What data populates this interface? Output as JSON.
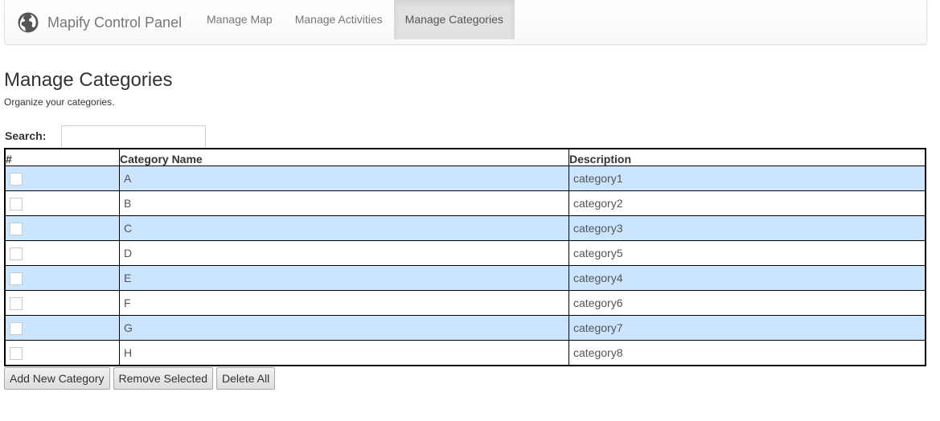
{
  "navbar": {
    "brand_icon": "globe-icon",
    "brand_label": "Mapify Control Panel",
    "items": [
      {
        "label": "Manage Map",
        "active": false
      },
      {
        "label": "Manage Activities",
        "active": false
      },
      {
        "label": "Manage Categories",
        "active": true
      }
    ]
  },
  "page": {
    "title": "Manage Categories",
    "subtitle": "Organize your categories."
  },
  "search": {
    "label": "Search:",
    "value": "",
    "placeholder": ""
  },
  "table": {
    "columns": [
      "#",
      "Category Name",
      "Description"
    ],
    "rows": [
      {
        "checked": false,
        "name": "A",
        "description": "category1"
      },
      {
        "checked": false,
        "name": "B",
        "description": "category2"
      },
      {
        "checked": false,
        "name": "C",
        "description": "category3"
      },
      {
        "checked": false,
        "name": "D",
        "description": "category5"
      },
      {
        "checked": false,
        "name": "E",
        "description": "category4"
      },
      {
        "checked": false,
        "name": "F",
        "description": "category6"
      },
      {
        "checked": false,
        "name": "G",
        "description": "category7"
      },
      {
        "checked": false,
        "name": "H",
        "description": "category8"
      }
    ],
    "row_highlight_color": "#cce5ff"
  },
  "actions": {
    "add_label": "Add New Category",
    "remove_label": "Remove Selected",
    "delete_all_label": "Delete All"
  }
}
